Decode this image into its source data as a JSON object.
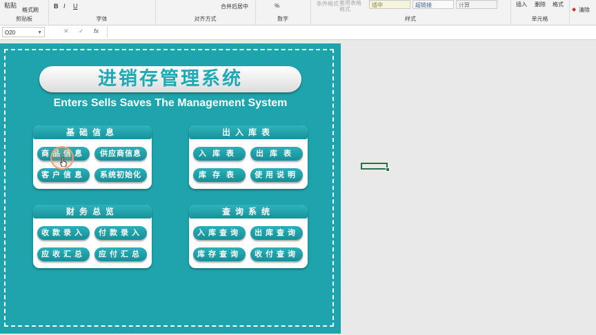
{
  "ribbon": {
    "clipboard": {
      "paste": "粘贴",
      "format_painter": "格式刷",
      "label": "剪贴板"
    },
    "font": {
      "bold": "B",
      "italic": "I",
      "underline": "U",
      "label": "字体"
    },
    "alignment": {
      "merge": "合并后居中",
      "label": "对齐方式"
    },
    "number": {
      "percent": "%",
      "label": "数字"
    },
    "styles": {
      "conditional": "条件格式",
      "table": "套用表格格式",
      "cell_moderate": "适中",
      "cell_hyperlink": "超链接",
      "cell_calc": "计算",
      "label": "样式"
    },
    "cells": {
      "insert": "插入",
      "delete": "删除",
      "format": "格式",
      "label": "单元格"
    },
    "editing": {
      "clear": "清除"
    }
  },
  "formula_bar": {
    "name_box": "O20",
    "fx": "fx",
    "value": ""
  },
  "dashboard": {
    "title": "进销存管理系统",
    "subtitle": "Enters Sells Saves The Management System",
    "sections": [
      {
        "title": "基础信息",
        "buttons": [
          "商品信息",
          "供应商信息",
          "客户信息",
          "系统初始化"
        ]
      },
      {
        "title": "出入库表",
        "buttons": [
          "入库表",
          "出库表",
          "库存表",
          "使用说明"
        ]
      },
      {
        "title": "财务总览",
        "buttons": [
          "收款录入",
          "付款录入",
          "应收汇总",
          "应付汇总"
        ]
      },
      {
        "title": "查询系统",
        "buttons": [
          "入库查询",
          "出库查询",
          "库存查询",
          "收付查询"
        ]
      }
    ]
  },
  "colors": {
    "panel": "#1fa4ad",
    "button": "#1c9ea7",
    "title_text": "#1eaab4",
    "selection": "#217346"
  },
  "icons": [
    "dropdown-arrow-icon",
    "cancel-x-icon",
    "confirm-check-icon",
    "fx-icon",
    "cursor-hand-icon"
  ]
}
